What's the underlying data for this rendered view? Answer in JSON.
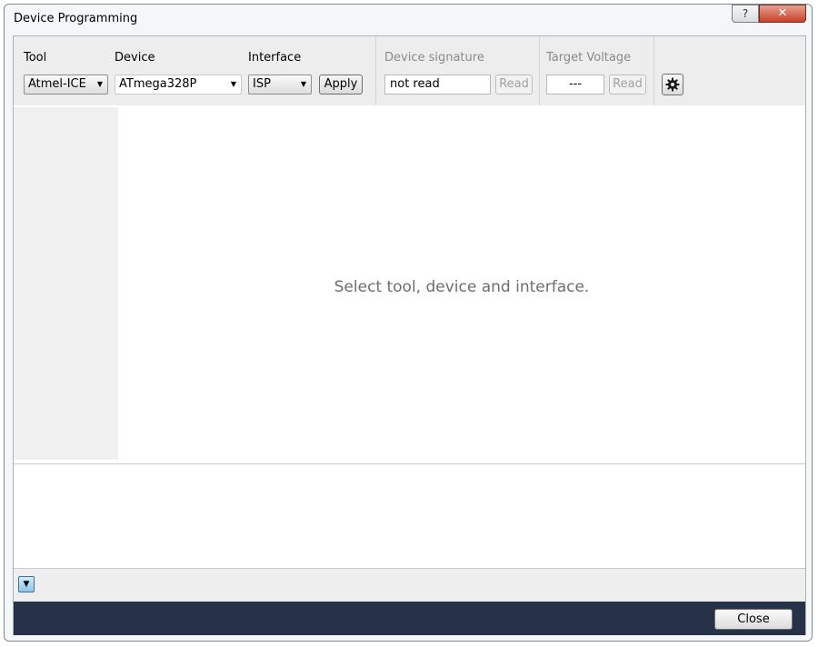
{
  "window": {
    "title": "Device Programming",
    "help_label": "?",
    "close_glyph": "✕"
  },
  "toolbar": {
    "tool": {
      "label": "Tool",
      "value": "Atmel-ICE"
    },
    "device": {
      "label": "Device",
      "value": "ATmega328P"
    },
    "interface": {
      "label": "Interface",
      "value": "ISP"
    },
    "apply_label": "Apply",
    "device_signature": {
      "label": "Device signature",
      "value": "not read",
      "read_label": "Read"
    },
    "target_voltage": {
      "label": "Target Voltage",
      "value": "---",
      "read_label": "Read"
    },
    "settings_icon": "gear-icon"
  },
  "main": {
    "message": "Select tool, device and interface."
  },
  "expander": {
    "glyph": "▼"
  },
  "footer": {
    "close_label": "Close"
  },
  "colors": {
    "footer_bg": "#263248",
    "close_x_bg": "#c9412a",
    "expander_bg": "#8fc6ea"
  }
}
